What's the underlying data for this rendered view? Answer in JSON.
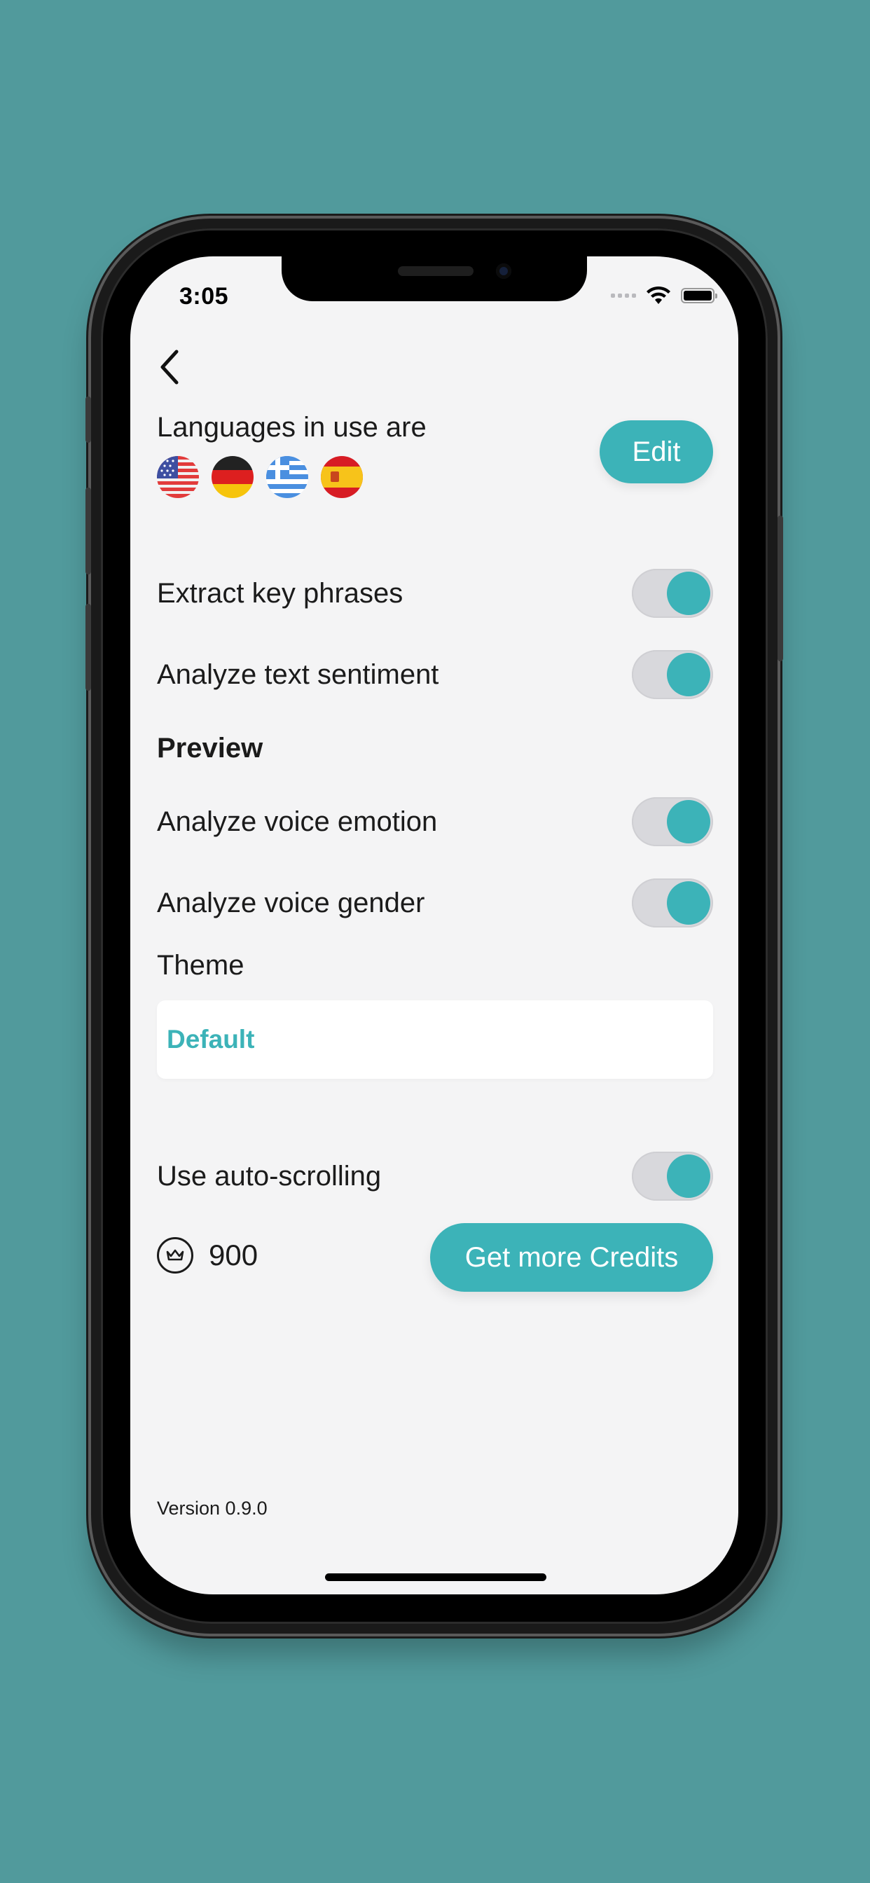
{
  "status_bar": {
    "time": "3:05"
  },
  "languages": {
    "title": "Languages in use are",
    "flags": [
      "us-flag-icon",
      "de-flag-icon",
      "gr-flag-icon",
      "es-flag-icon"
    ],
    "edit_label": "Edit"
  },
  "settings": {
    "extract_key_phrases": {
      "label": "Extract key phrases",
      "enabled": true
    },
    "analyze_text_sentiment": {
      "label": "Analyze text sentiment",
      "enabled": true
    }
  },
  "preview": {
    "title": "Preview",
    "analyze_voice_emotion": {
      "label": "Analyze voice emotion",
      "enabled": true
    },
    "analyze_voice_gender": {
      "label": "Analyze voice gender",
      "enabled": true
    }
  },
  "theme": {
    "label": "Theme",
    "selected": "Default"
  },
  "auto_scrolling": {
    "label": "Use auto-scrolling",
    "enabled": true
  },
  "credits": {
    "count": "900",
    "button_label": "Get more Credits",
    "icon": "crown-icon"
  },
  "version": "Version 0.9.0",
  "colors": {
    "accent": "#3cb3b8",
    "background": "#519a9c",
    "screen": "#f4f4f5",
    "toggle_track": "#d8d8dc"
  }
}
